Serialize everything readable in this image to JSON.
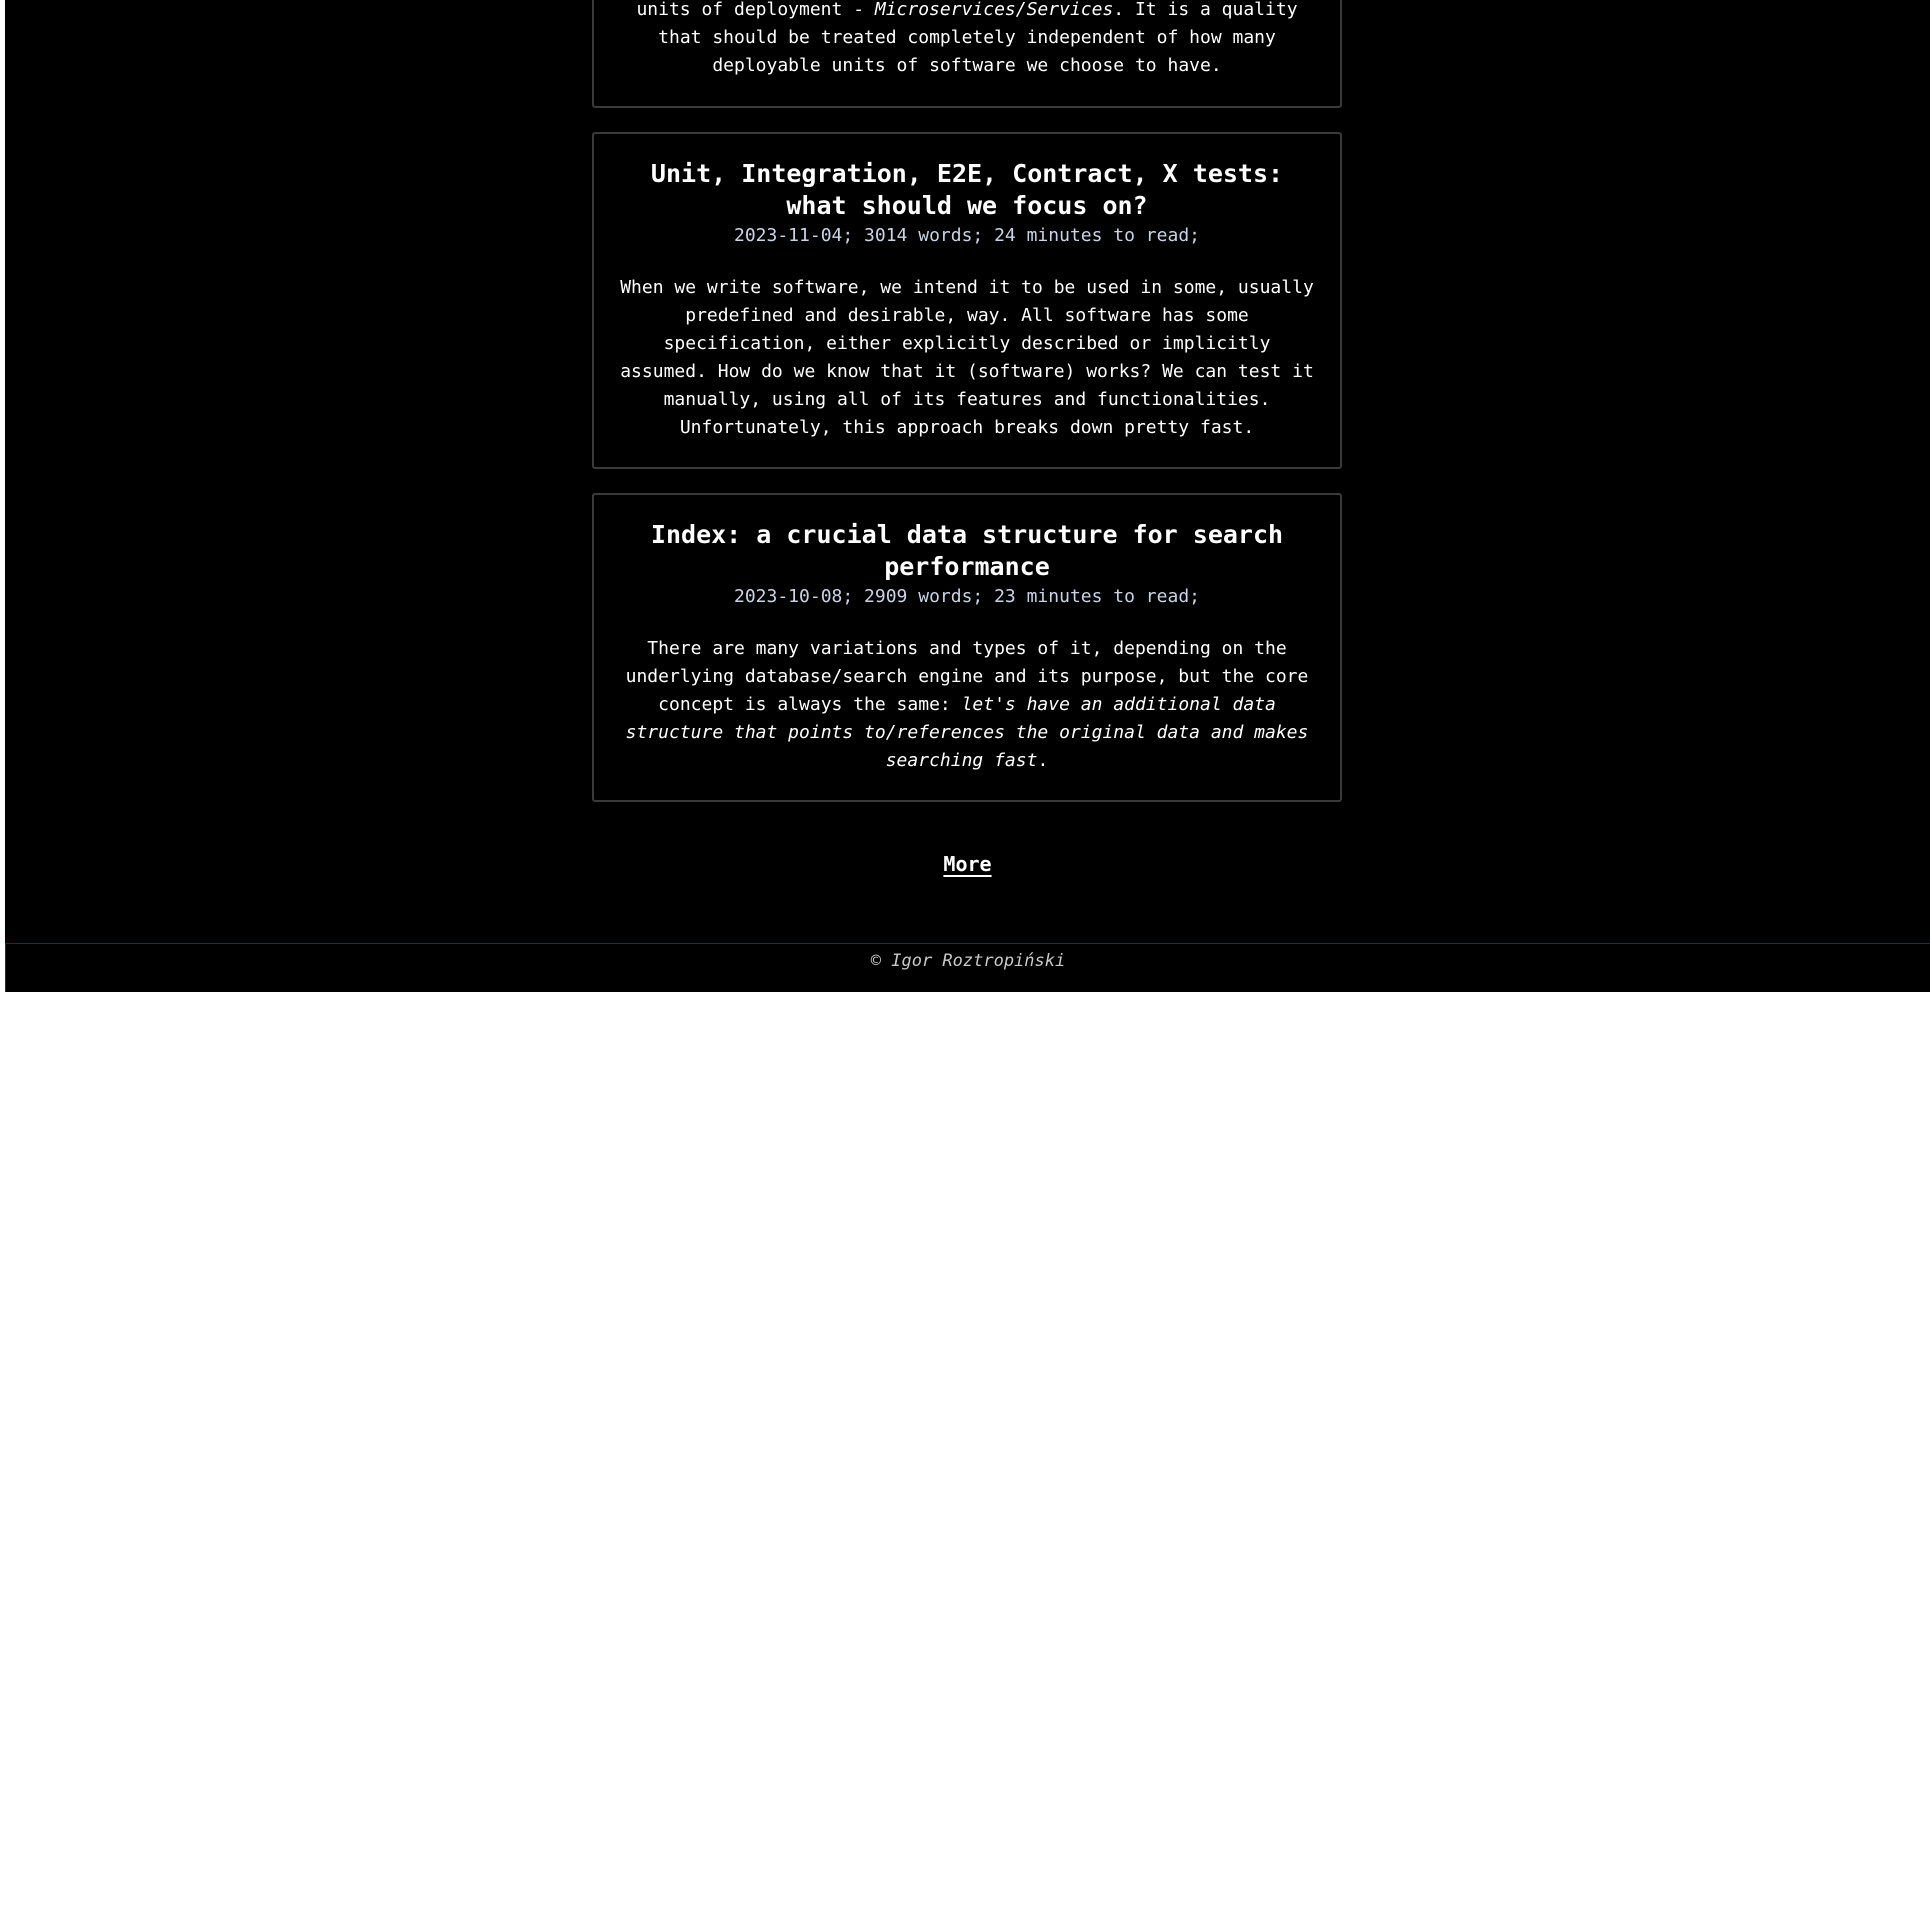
{
  "posts": [
    {
      "excerpt_lines": [
        {
          "parts": [
            {
              "text": "units of deployment - "
            },
            {
              "text": "Microservices/Services",
              "italic": true
            },
            {
              "text": ". It is a quality"
            }
          ]
        },
        {
          "parts": [
            {
              "text": "that should be treated completely independent of how many"
            }
          ]
        },
        {
          "parts": [
            {
              "text": "deployable units of software we choose to have."
            }
          ]
        }
      ]
    },
    {
      "title": "Unit, Integration, E2E, Contract, X tests: what should we focus on?",
      "meta": "2023-11-04; 3014 words; 24 minutes to read;",
      "excerpt_lines": [
        {
          "parts": [
            {
              "text": "When we write software, we intend it to be used in some, usually"
            }
          ]
        },
        {
          "parts": [
            {
              "text": "predefined and desirable, way. All software has some"
            }
          ]
        },
        {
          "parts": [
            {
              "text": "specification, either explicitly described or implicitly"
            }
          ]
        },
        {
          "parts": [
            {
              "text": "assumed. How do we know that it (software) works? We can test it"
            }
          ]
        },
        {
          "parts": [
            {
              "text": "manually, using all of its features and functionalities."
            }
          ]
        },
        {
          "parts": [
            {
              "text": "Unfortunately, this approach breaks down pretty fast."
            }
          ]
        }
      ]
    },
    {
      "title": "Index: a crucial data structure for search performance",
      "meta": "2023-10-08; 2909 words; 23 minutes to read;",
      "excerpt_lines": [
        {
          "parts": [
            {
              "text": "There are many variations and types of it, depending on the"
            }
          ]
        },
        {
          "parts": [
            {
              "text": "underlying database/search engine and its purpose, but the core"
            }
          ]
        },
        {
          "parts": [
            {
              "text": "concept is always the same: "
            },
            {
              "text": "let's have an additional data",
              "italic": true
            }
          ]
        },
        {
          "parts": [
            {
              "text": "structure that points to/references the original data and makes",
              "italic": true
            }
          ]
        },
        {
          "parts": [
            {
              "text": "searching fast",
              "italic": true
            },
            {
              "text": "."
            }
          ]
        }
      ]
    }
  ],
  "more_label": "More",
  "footer": {
    "copyright": "© Igor Roztropiński"
  },
  "colors": {
    "background": "#000000",
    "text": "#ffffff",
    "meta": "#c8d4e6",
    "card_border": "#3a3a3a",
    "footer_border": "#8b0000"
  }
}
